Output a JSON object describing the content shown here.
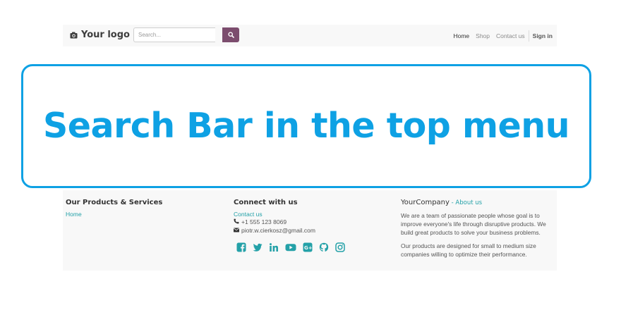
{
  "navbar": {
    "logo_text": "Your logo",
    "search_placeholder": "Search...",
    "links": [
      "Home",
      "Shop",
      "Contact us"
    ],
    "signin": "Sign in"
  },
  "callout": {
    "text": "Search Bar in the top menu",
    "color": "#0ea1e4"
  },
  "footer": {
    "products": {
      "title": "Our Products & Services",
      "home_link": "Home"
    },
    "connect": {
      "title": "Connect with us",
      "contact_link": "Contact us",
      "phone": "+1 555 123 8069",
      "email": "piotr.w.cierkosz@gmail.com",
      "social_icons": [
        "facebook-icon",
        "twitter-icon",
        "linkedin-icon",
        "youtube-icon",
        "google-plus-icon",
        "github-icon",
        "instagram-icon"
      ]
    },
    "company": {
      "name": "YourCompany",
      "sep": " - ",
      "about_link": "About us",
      "paragraph1": "We are a team of passionate people whose goal is to improve everyone's life through disruptive products. We build great products to solve your business problems.",
      "paragraph2": "Our products are designed for small to medium size companies willing to optimize their performance."
    }
  },
  "colors": {
    "brand": "#7c4d6e",
    "link": "#24a1a8",
    "background_bar": "#f8f8f8"
  }
}
